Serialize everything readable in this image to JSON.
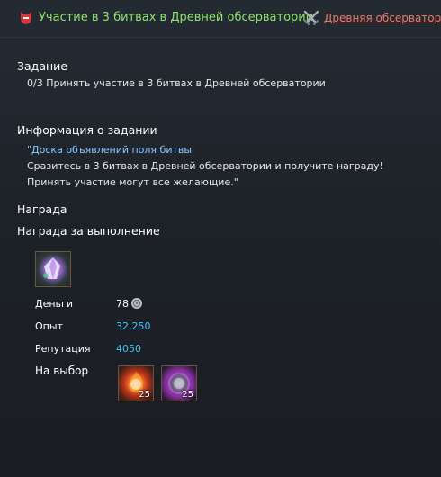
{
  "header": {
    "quest_title": "Участие в 3 битвах в Древней обсерватории",
    "location_link": "Древняя обсерватория"
  },
  "task": {
    "heading": "Задание",
    "objective": "0/3 Принять участие в 3 битвах в Древней обсерватории"
  },
  "info": {
    "heading": "Информация о задании",
    "lines": [
      "\"Доска объявлений поля битвы",
      "Сразитесь в 3 битвах в Древней обсерватории и получите награду!",
      "Принять участие могут все желающие.\""
    ]
  },
  "reward": {
    "heading": "Награда",
    "completion_heading": "Награда за выполнение",
    "money_label": "Деньги",
    "money_value": "78",
    "exp_label": "Опыт",
    "exp_value": "32,250",
    "rep_label": "Репутация",
    "rep_value": "4050",
    "choice_label": "На выбор",
    "choices": [
      {
        "icon": "fire-orb-icon",
        "count": "25"
      },
      {
        "icon": "dark-orb-icon",
        "count": "25"
      }
    ]
  },
  "colors": {
    "quest_title": "#8ee46e",
    "location_link": "#e9796a",
    "info_highlight": "#8ec9ff",
    "stat_value": "#3ec8f5"
  }
}
